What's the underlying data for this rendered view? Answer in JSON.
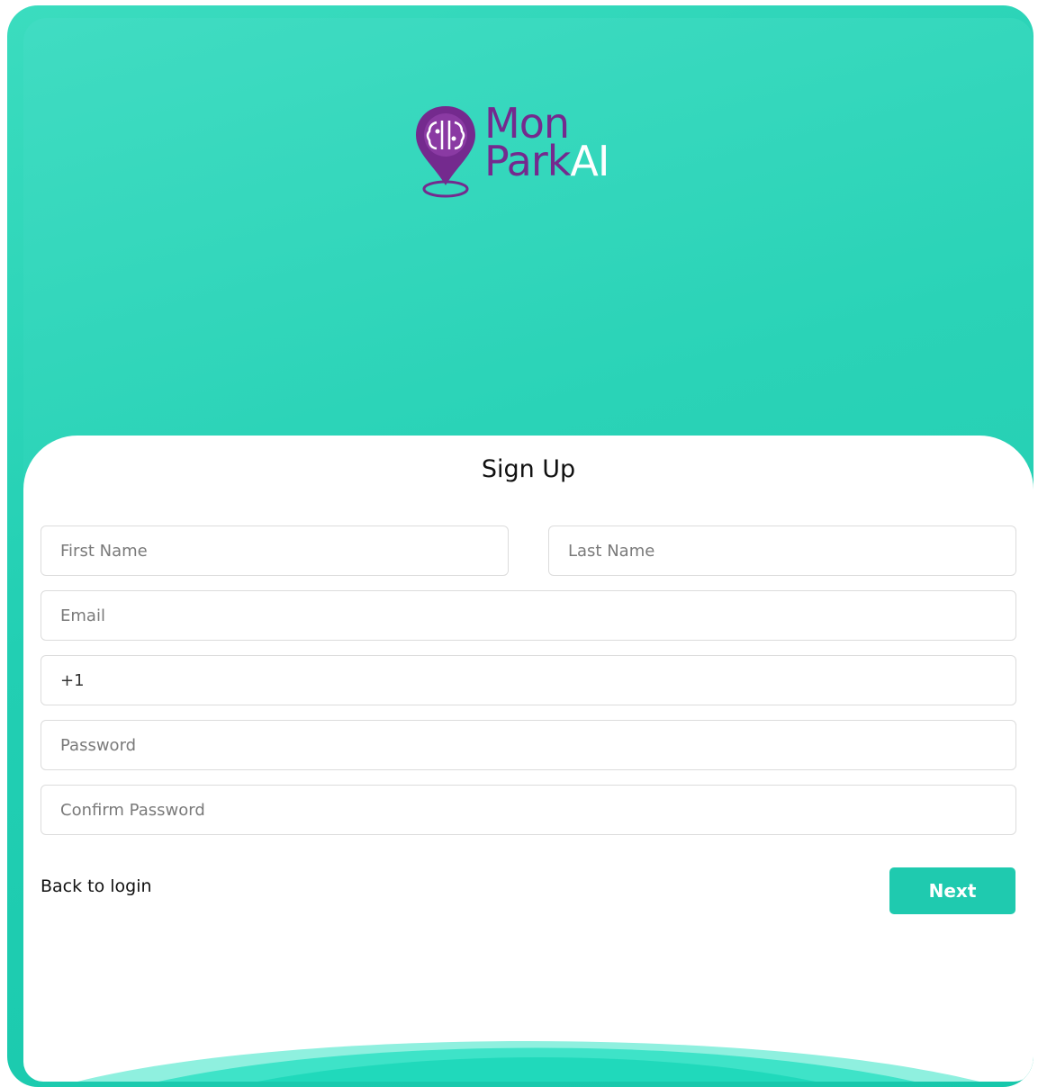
{
  "brand": {
    "name_line1": "Mon",
    "name_line2_part1": "Park",
    "name_line2_part2": "AI",
    "colors": {
      "purple": "#742a8e",
      "teal": "#1fcaaf"
    }
  },
  "form": {
    "title": "Sign Up",
    "fields": {
      "first_name": {
        "placeholder": "First Name",
        "value": ""
      },
      "last_name": {
        "placeholder": "Last Name",
        "value": ""
      },
      "email": {
        "placeholder": "Email",
        "value": ""
      },
      "phone": {
        "placeholder": "",
        "value": "+1"
      },
      "password": {
        "placeholder": "Password",
        "value": ""
      },
      "confirm_password": {
        "placeholder": "Confirm Password",
        "value": ""
      }
    },
    "back_link_label": "Back to login",
    "next_label": "Next"
  }
}
